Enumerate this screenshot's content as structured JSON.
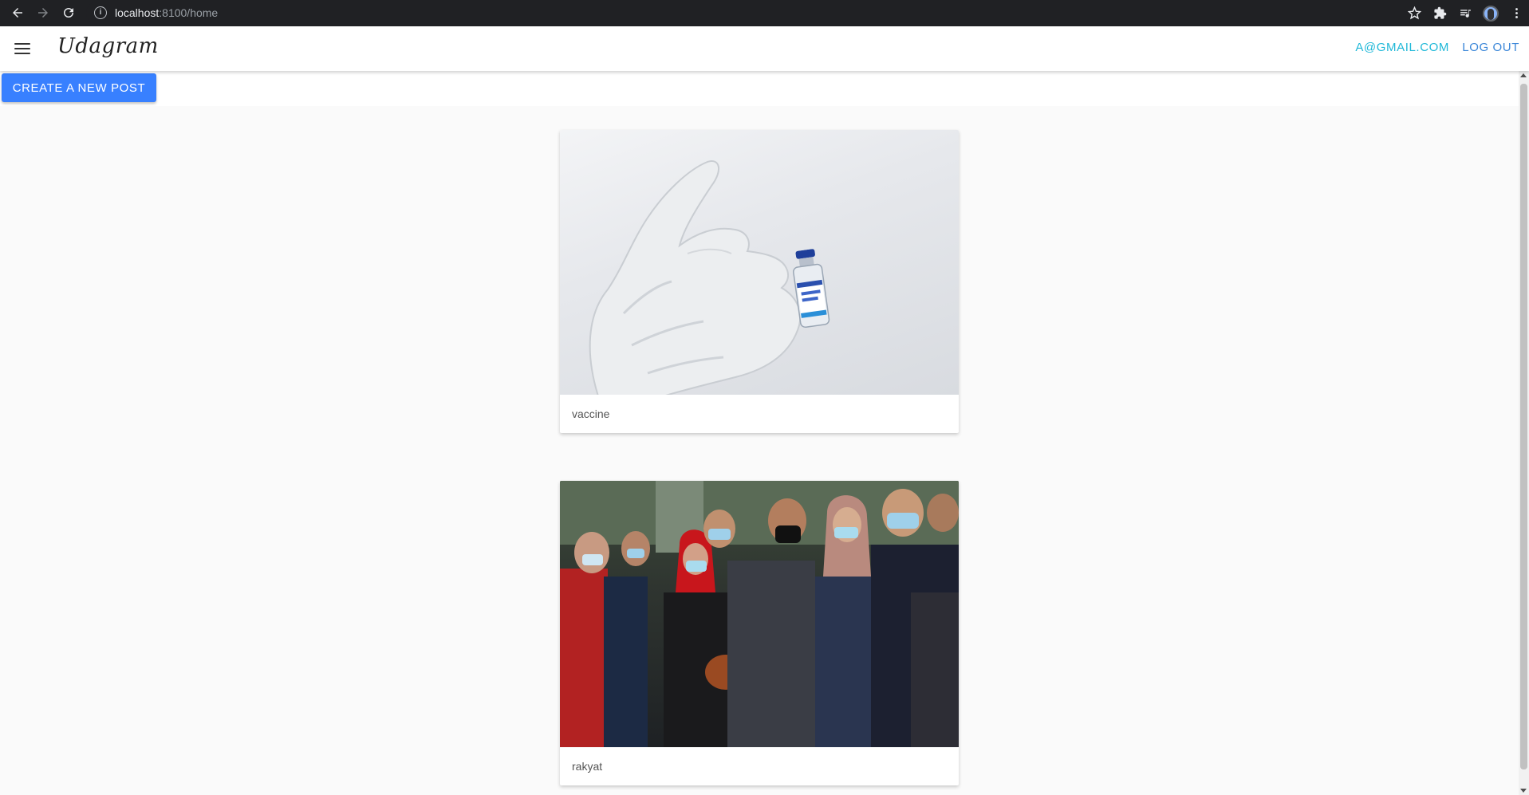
{
  "browser": {
    "url_host": "localhost",
    "url_rest": ":8100/home",
    "info_icon": "info-icon",
    "icons": [
      "back-arrow-icon",
      "forward-arrow-icon",
      "reload-icon",
      "star-icon",
      "extensions-icon",
      "media-controls-icon",
      "profile-avatar",
      "more-vertical-icon"
    ]
  },
  "toolbar": {
    "brand": "Udagram",
    "user_email": "A@GMAIL.COM",
    "logout_label": "LOG OUT",
    "menu_icon": "hamburger-menu-icon"
  },
  "main": {
    "create_button_label": "CREATE A NEW POST",
    "posts": [
      {
        "caption": "vaccine",
        "image": "vaccine-vial-in-gloved-hand"
      },
      {
        "caption": "rakyat",
        "image": "crowd-wearing-face-masks"
      }
    ]
  },
  "colors": {
    "primary_button": "#3880ff",
    "user_link": "#1fb8d8",
    "logout_link": "#3a86d8",
    "browser_chrome": "#202124"
  }
}
